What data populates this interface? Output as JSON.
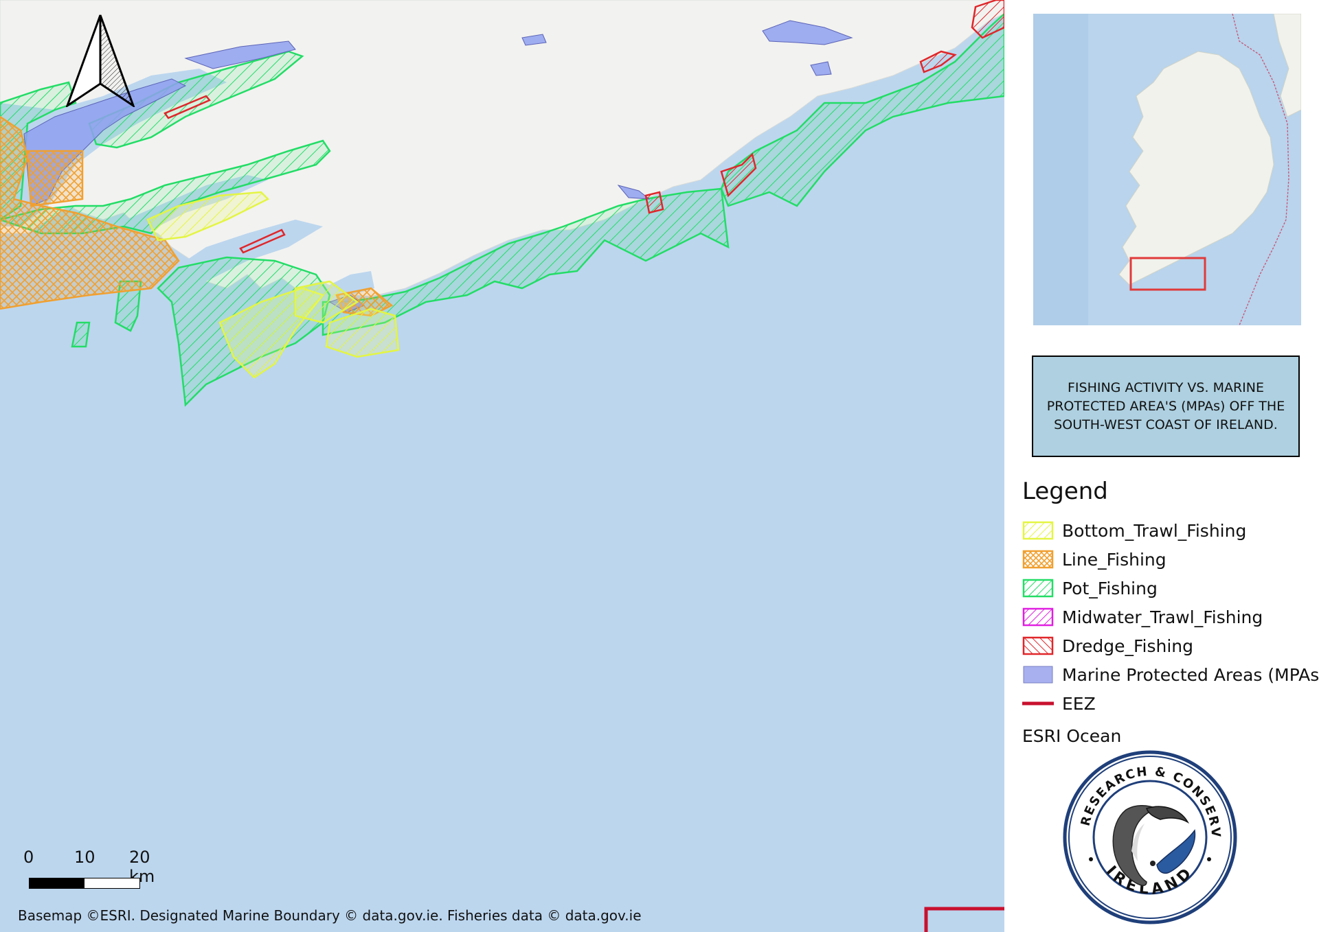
{
  "map": {
    "north_arrow_icon": "north-arrow-icon",
    "scale_bar": {
      "labels": [
        "0",
        "10",
        "20 km"
      ]
    },
    "attribution": "Basemap ©ESRI. Designated Marine Boundary © data.gov.ie. Fisheries data © data.gov.ie",
    "colors": {
      "ocean": "#bcd6ee",
      "land": "#f2f2f0",
      "bottom_trawl": "#e4f542",
      "line_fishing": "#f0a030",
      "pot_fishing": "#22dd66",
      "midwater_trawl": "#e020e0",
      "dredge": "#e0262a",
      "mpa": "#8fa0f0",
      "eez": "#c8102e"
    }
  },
  "inset_map": {
    "extent_box_color": "#e03a3a"
  },
  "title_box": {
    "text": "FISHING ACTIVITY VS. MARINE PROTECTED AREA'S (MPAs) OFF THE SOUTH-WEST COAST OF IRELAND."
  },
  "legend": {
    "title": "Legend",
    "items": [
      {
        "label": "Bottom_Trawl_Fishing",
        "symbol": "hatch",
        "color": "#e4f542"
      },
      {
        "label": "Line_Fishing",
        "symbol": "crosshatch",
        "color": "#f0a030"
      },
      {
        "label": "Pot_Fishing",
        "symbol": "hatch",
        "color": "#22dd66"
      },
      {
        "label": "Midwater_Trawl_Fishing",
        "symbol": "hatch",
        "color": "#e020e0"
      },
      {
        "label": "Dredge_Fishing",
        "symbol": "hatch",
        "color": "#e0262a"
      },
      {
        "label": "Marine Protected Areas (MPAs)",
        "symbol": "fill",
        "color": "#a8b0f0"
      },
      {
        "label": "EEZ",
        "symbol": "line",
        "color": "#c8102e"
      }
    ],
    "basemap_label": "ESRI Ocean"
  },
  "logo": {
    "top_text": "OCEAN RESEARCH & CONSERVATION",
    "bottom_text": "IRELAND"
  }
}
